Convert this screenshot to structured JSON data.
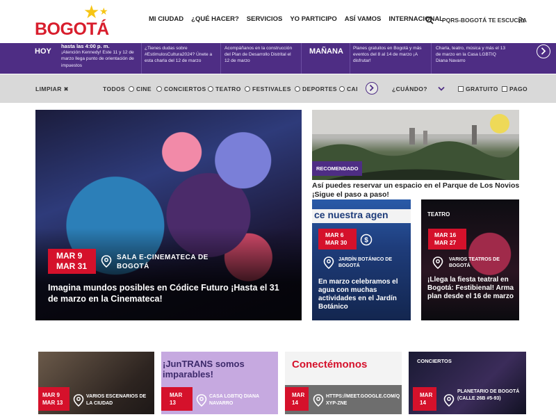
{
  "header": {
    "logo_text": "BOGOTÁ",
    "nav": [
      "MI CIUDAD",
      "¿QUÉ HACER?",
      "SERVICIOS",
      "YO PARTICIPO",
      "ASÍ VAMOS",
      "INTERNACIONAL"
    ],
    "pqrs": "PQRS-BOGOTÁ TE ESCUCHA"
  },
  "ticker": {
    "today_label": "HOY",
    "tomorrow_label": "MAÑANA",
    "today_time": "hasta las 4:00 p. m.",
    "today_items": [
      "¡Atención Kennedy! Este 11 y 12 de marzo llega punto de orientación de impuestos",
      "¿Tienes dudas sobre #EstímulosCultura2024? Únete a esta charla del 12 de marzo",
      "Acompáñanos en la construcción del Plan de Desarrollo Distrital el 12 de marzo"
    ],
    "tomorrow_items": [
      "Planes gratuitos en Bogotá y más eventos del 8 al 14 de marzo ¡A disfrutar!",
      "Charla, teatro, música y más el 13 de marzo en la Casa LGBTIQ Diana Navarro"
    ]
  },
  "filter": {
    "clear": "LIMPIAR ✖",
    "categories": [
      "TODOS",
      "CINE",
      "CONCIERTOS",
      "TEATRO",
      "FESTIVALES",
      "DEPORTES",
      "CAI"
    ],
    "when": "¿CUÁNDO?",
    "options": [
      "GRATUITO",
      "PAGO"
    ]
  },
  "hero": {
    "date_from": "MAR   9",
    "date_to": "MAR  31",
    "location": "SALA E-CINEMATECA DE BOGOTÁ",
    "title": "Imagina mundos posibles en Códice Futuro ¡Hasta el 31 de marzo en la Cinemateca!"
  },
  "park": {
    "tag": "RECOMENDADO",
    "title": "Así puedes reservar un espacio en el Parque de Los Novios ¡Sigue el paso a paso!"
  },
  "jardin": {
    "banner": "ce nuestra agen",
    "date_from": "MAR   6",
    "date_to": "MAR  30",
    "location": "JARDÍN BOTÁNICO DE BOGOTÁ",
    "title": "En marzo celebramos el agua con muchas actividades en el Jardín Botánico"
  },
  "teatro": {
    "category": "TEATRO",
    "date_from": "MAR  16",
    "date_to": "MAR  27",
    "location": "VARIOS TEATROS DE BOGOTÁ",
    "title": "¡Llega la fiesta teatral en Bogotá: Festibienal! Arma plan desde el 16 de marzo"
  },
  "bottom": [
    {
      "date_from": "MAR   9",
      "date_to": "MAR  13",
      "location": "VARIOS ESCENARIOS DE LA CIUDAD",
      "tag": "",
      "banner": ""
    },
    {
      "date_from": "MAR",
      "date_to": "13",
      "location": "CASA LGBTIQ DIANA NAVARRO",
      "tag": "",
      "banner": "¡JunTRANS somos imparables!"
    },
    {
      "date_from": "MAR",
      "date_to": "14",
      "location": "HTTPS://MEET.GOOGLE.COM/QXYP-ZNE",
      "tag": "",
      "banner": "Conectémonos"
    },
    {
      "date_from": "MAR",
      "date_to": "14",
      "location": "PLANETARIO DE BOGOTÁ (CALLE 26B #5-93)",
      "tag": "CONCIERTOS",
      "banner": ""
    }
  ]
}
